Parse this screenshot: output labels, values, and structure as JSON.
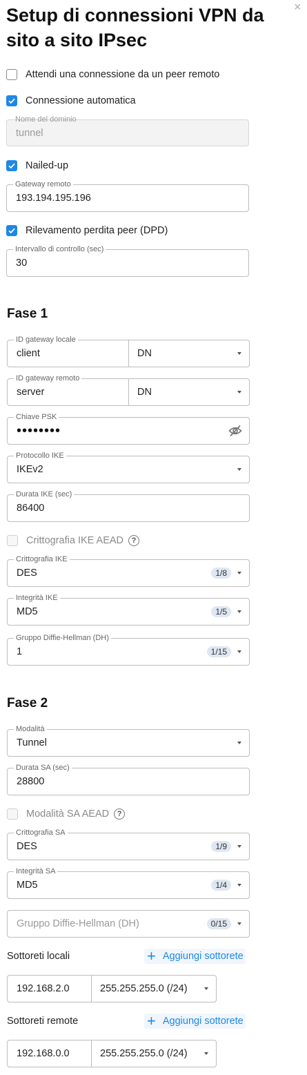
{
  "title": "Setup di connessioni VPN da sito a sito IPsec",
  "close_icon": "close-icon",
  "wait_remote": {
    "label": "Attendi una connessione da un peer remoto",
    "checked": false
  },
  "auto_connect": {
    "label": "Connessione automatica",
    "checked": true
  },
  "domain_name": {
    "label": "Nome del dominio",
    "value": "tunnel",
    "disabled": true
  },
  "nailed_up": {
    "label": "Nailed-up",
    "checked": true
  },
  "remote_gateway": {
    "label": "Gateway remoto",
    "value": "193.194.195.196"
  },
  "dpd": {
    "label": "Rilevamento perdita peer (DPD)",
    "checked": true
  },
  "check_interval": {
    "label": "Intervallo di controllo (sec)",
    "value": "30"
  },
  "phase1": {
    "title": "Fase 1",
    "local_gw_id": {
      "label": "ID gateway locale",
      "value": "client",
      "type": "DN"
    },
    "remote_gw_id": {
      "label": "ID gateway remoto",
      "value": "server",
      "type": "DN"
    },
    "psk": {
      "label": "Chiave PSK",
      "value": "••••••••"
    },
    "ike_protocol": {
      "label": "Protocollo IKE",
      "value": "IKEv2"
    },
    "ike_duration": {
      "label": "Durata IKE (sec)",
      "value": "86400"
    },
    "ike_aead": {
      "label": "Crittografia IKE AEAD",
      "checked": false,
      "disabled": true
    },
    "ike_encryption": {
      "label": "Crittografia IKE",
      "value": "DES",
      "count": "1/8"
    },
    "ike_integrity": {
      "label": "Integrità IKE",
      "value": "MD5",
      "count": "1/5"
    },
    "dh_group": {
      "label": "Gruppo Diffie-Hellman (DH)",
      "value": "1",
      "count": "1/15"
    }
  },
  "phase2": {
    "title": "Fase 2",
    "mode": {
      "label": "Modalità",
      "value": "Tunnel"
    },
    "sa_duration": {
      "label": "Durata SA (sec)",
      "value": "28800"
    },
    "sa_aead": {
      "label": "Modalità SA AEAD",
      "checked": false,
      "disabled": true
    },
    "sa_encryption": {
      "label": "Crittografia SA",
      "value": "DES",
      "count": "1/9"
    },
    "sa_integrity": {
      "label": "Integrità SA",
      "value": "MD5",
      "count": "1/4"
    },
    "dh_group": {
      "placeholder": "Gruppo Diffie-Hellman (DH)",
      "count": "0/15"
    }
  },
  "local_subnets": {
    "label": "Sottoreti locali",
    "add_label": "Aggiungi sottorete",
    "rows": [
      {
        "ip": "192.168.2.0",
        "mask": "255.255.255.0 (/24)"
      }
    ]
  },
  "remote_subnets": {
    "label": "Sottoreti remote",
    "add_label": "Aggiungi sottorete",
    "rows": [
      {
        "ip": "192.168.0.0",
        "mask": "255.255.255.0 (/24)"
      }
    ]
  },
  "colors": {
    "accent": "#1e88e5",
    "badge_bg": "#dfe7f2",
    "border": "#bdbdbd"
  }
}
